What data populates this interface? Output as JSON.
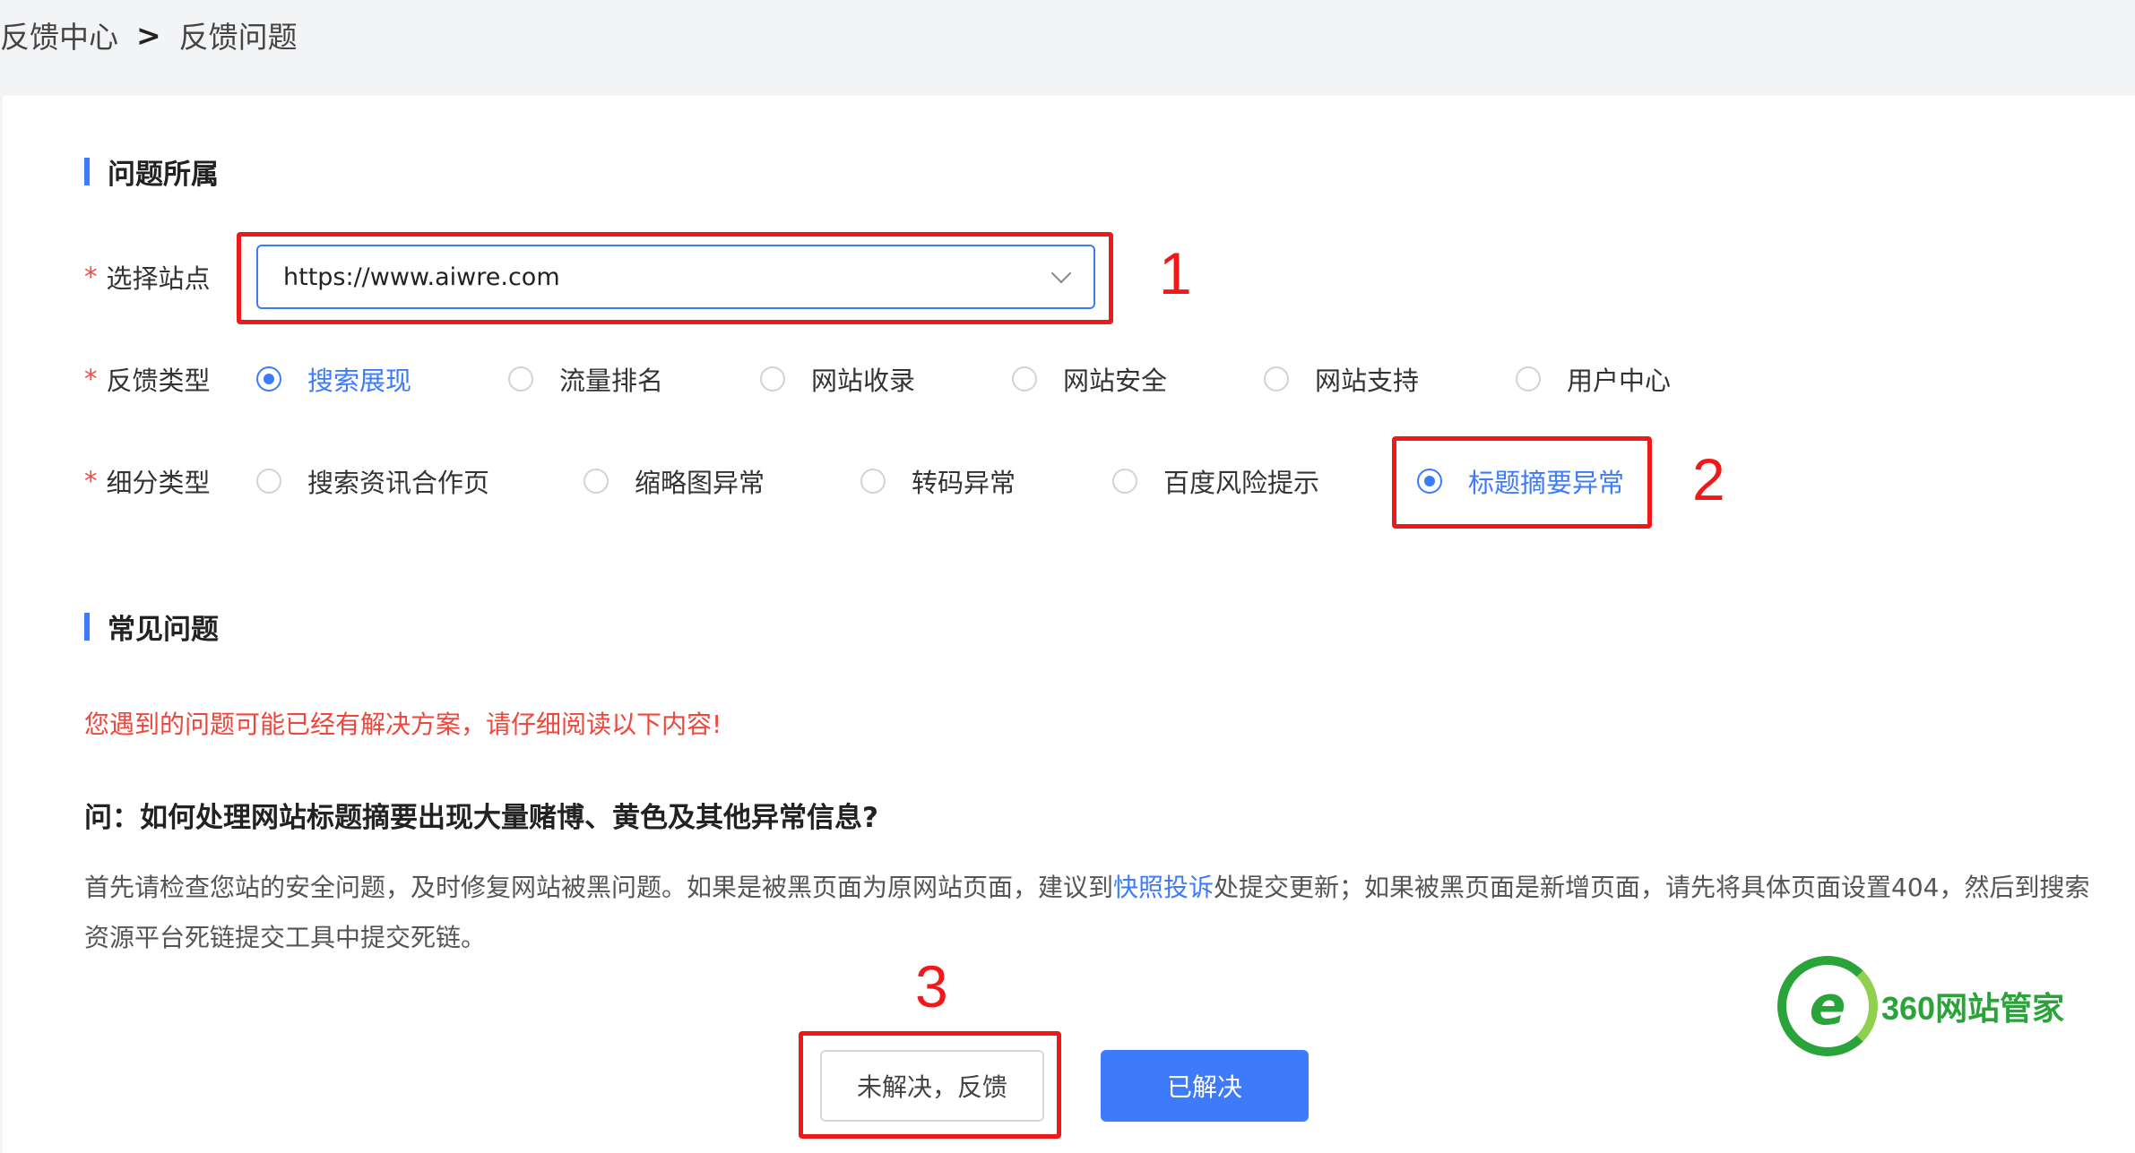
{
  "breadcrumb": {
    "parent": "反馈中心",
    "separator": ">",
    "current": "反馈问题"
  },
  "section1": {
    "title": "问题所属"
  },
  "site": {
    "label": "选择站点",
    "required_mark": "*",
    "value": "https://www.aiwre.com"
  },
  "feedback_type": {
    "label": "反馈类型",
    "required_mark": "*",
    "options": [
      "搜索展现",
      "流量排名",
      "网站收录",
      "网站安全",
      "网站支持",
      "用户中心"
    ],
    "selected_index": 0
  },
  "sub_type": {
    "label": "细分类型",
    "required_mark": "*",
    "options": [
      "搜索资讯合作页",
      "缩略图异常",
      "转码异常",
      "百度风险提示",
      "标题摘要异常"
    ],
    "selected_index": 4
  },
  "annotations": {
    "n1": "1",
    "n2": "2",
    "n3": "3",
    "color": "#f01818"
  },
  "section2": {
    "title": "常见问题"
  },
  "notice": "您遇到的问题可能已经有解决方案，请仔细阅读以下内容!",
  "faq": {
    "question": "问：如何处理网站标题摘要出现大量赌博、黄色及其他异常信息?",
    "answer_part1": "首先请检查您站的安全问题，及时修复网站被黑问题。如果是被黑页面为原网站页面，建议到",
    "answer_link": "快照投诉",
    "answer_part2": "处提交更新；如果被黑页面是新增页面，请先将具体页面设置404，然后到搜索资源平台死链提交工具中提交死链。"
  },
  "buttons": {
    "unresolved": "未解决，反馈",
    "resolved": "已解决"
  },
  "watermark": {
    "logo_letter": "e",
    "text": "360网站管家"
  },
  "colors": {
    "accent": "#3e7bfa",
    "danger": "#f04b4b",
    "watermark": "#2aa33a"
  }
}
